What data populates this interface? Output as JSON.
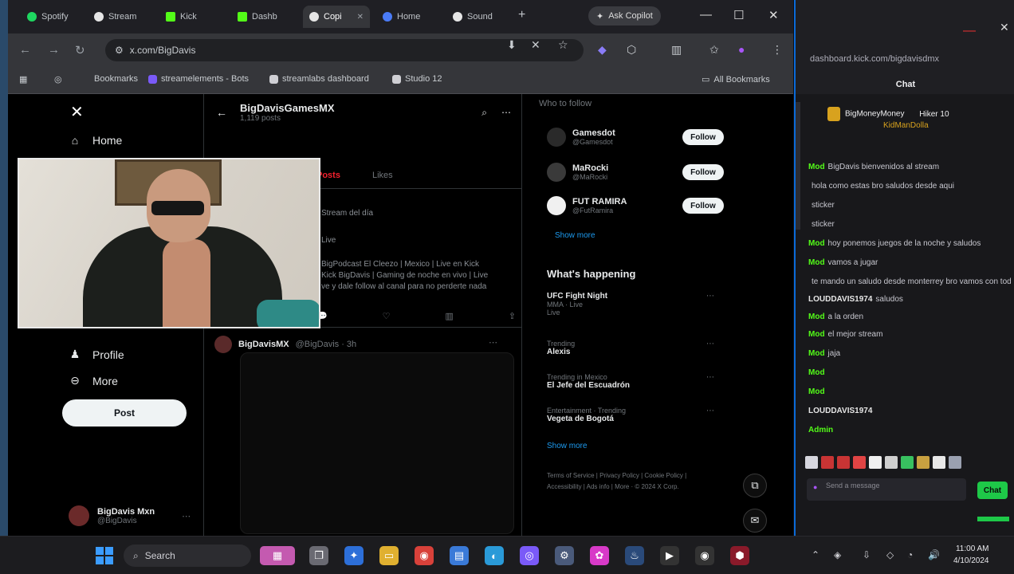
{
  "browser": {
    "tabs": [
      {
        "label": "Spotify",
        "color": "#1ed760"
      },
      {
        "label": "Stream",
        "color": "#e6e6e6"
      },
      {
        "label": "Kick",
        "color": "#53fc18"
      },
      {
        "label": "Dashb",
        "color": "#53fc18"
      },
      {
        "label": "Copi",
        "color": "#e6e6e6"
      },
      {
        "label": "Home",
        "color": "#4a7bf7"
      },
      {
        "label": "Sound",
        "color": "#e6e6e6"
      }
    ],
    "copilot_label": "Ask Copilot",
    "url": "x.com/BigDavis",
    "bookmarks": [
      "Bookmarks",
      "streamelements - Bots",
      "streamlabs dashboard",
      "Studio 12"
    ],
    "all_bookmarks": "All Bookmarks"
  },
  "twitter": {
    "nav": {
      "home": "Home",
      "profile": "Profile",
      "more": "More",
      "post_button": "Post"
    },
    "account": {
      "name": "BigDavis Mxn",
      "handle": "@BigDavis"
    },
    "profile_header": {
      "title": "BigDavisGamesMX",
      "subtitle": "1,119 posts"
    },
    "tabs": [
      "Posts",
      "Likes"
    ],
    "tweet1": {
      "lines": [
        "Stream del día",
        "Live",
        "BigPodcast El Cleezo | Mexico | Live en Kick",
        "Kick BigDavis | Gaming de noche en vivo | Live",
        "ve y dale follow al canal para no perderte nada"
      ]
    },
    "tweet2": {
      "name": "BigDavisMX",
      "handle": "@BigDavis · 3h"
    },
    "who_to_follow": {
      "header": "Who to follow",
      "suggestions": [
        {
          "name": "Gamesdot",
          "handle": "@Gamesdot",
          "button": "Follow"
        },
        {
          "name": "MaRocki",
          "handle": "@MaRocki",
          "button": "Follow"
        },
        {
          "name": "FUT RAMIRA",
          "handle": "@FutRamira",
          "button": "Follow"
        }
      ],
      "show_more": "Show more"
    },
    "whats_happening": {
      "title": "What's happening",
      "trends": [
        {
          "category": "MMA · Live",
          "name": "UFC Fight Night",
          "meta": "Live"
        },
        {
          "category": "Trending",
          "name": "Alexis",
          "meta": ""
        },
        {
          "category": "Trending in Mexico",
          "name": "El Jefe del Escuadrón",
          "meta": ""
        },
        {
          "category": "Entertainment · Trending",
          "name": "Vegeta de Bogotá",
          "meta": ""
        }
      ],
      "show_more": "Show more"
    },
    "footer": "Terms of Service | Privacy Policy | Cookie Policy | Accessibility | Ads info | More · © 2024 X Corp."
  },
  "chat": {
    "url": "dashboard.kick.com/bigdavisdmx",
    "title": "Chat",
    "pinned": {
      "user": "BigMoneyMoney",
      "line2": "Hiker 10",
      "gifter": "KidManDolla"
    },
    "messages": [
      {
        "user": "Mod",
        "text": "BigDavis bienvenidos al stream",
        "color": "#53fc18"
      },
      {
        "user": "",
        "text": "hola como estas bro saludos desde aqui",
        "color": "#e6e6e6"
      },
      {
        "user": "",
        "text": "sticker",
        "color": "#3a8dff"
      },
      {
        "user": "",
        "text": "sticker",
        "color": "#3a8dff"
      },
      {
        "user": "Mod",
        "text": "hoy ponemos juegos de la noche y saludos",
        "color": "#53fc18"
      },
      {
        "user": "Mod",
        "text": "vamos a jugar",
        "color": "#53fc18"
      },
      {
        "user": "",
        "text": "te mando un saludo desde monterrey bro vamos con todo",
        "color": "#e6e6e6"
      },
      {
        "user": "LOUDDAVIS1974",
        "text": "saludos",
        "color": "#e6e6e6"
      },
      {
        "user": "Mod",
        "text": "a la orden",
        "color": "#53fc18"
      },
      {
        "user": "Mod",
        "text": "el mejor stream",
        "color": "#53fc18"
      },
      {
        "user": "Mod",
        "text": "jaja",
        "color": "#53fc18"
      },
      {
        "user": "Mod",
        "text": "",
        "color": "#53fc18"
      },
      {
        "user": "Mod",
        "text": "",
        "color": "#53fc18"
      },
      {
        "user": "LOUDDAVIS1974",
        "text": "",
        "color": "#e6e6e6"
      },
      {
        "user": "Admin",
        "text": "",
        "color": "#53fc18"
      }
    ],
    "input_placeholder": "Send a message",
    "send_label": "Chat"
  },
  "taskbar": {
    "search_label": "Search",
    "time": "11:00 AM",
    "date": "4/10/2024"
  }
}
